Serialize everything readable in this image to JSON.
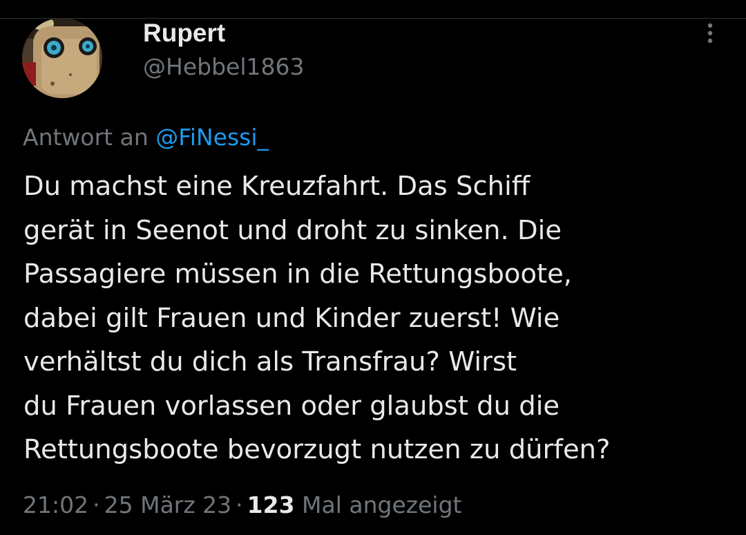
{
  "tweet": {
    "author": {
      "display_name": "Rupert",
      "handle": "@Hebbel1863",
      "avatar_icon": "profile-avatar"
    },
    "menu_icon": "more-vertical-icon",
    "reply": {
      "prefix": "Antwort an",
      "mention": "@FiNessi_"
    },
    "text_lines": [
      "Du machst eine Kreuzfahrt. Das Schiff",
      "gerät in Seenot und droht zu sinken. Die",
      "Passagiere müssen in die Rettungsboote,",
      "dabei gilt Frauen und Kinder zuerst! Wie",
      "verhältst du dich als Transfrau? Wirst",
      "du Frauen vorlassen oder glaubst du die",
      "Rettungsboote bevorzugt nutzen zu dürfen?"
    ],
    "meta": {
      "time": "21:02",
      "separator": "·",
      "date": "25 März 23",
      "views_count": "123",
      "views_label": "Mal angezeigt"
    }
  },
  "colors": {
    "background": "#000000",
    "text_primary": "#e7e9ea",
    "text_secondary": "#71767b",
    "accent_link": "#1d9bf0",
    "divider": "#2f3336"
  }
}
